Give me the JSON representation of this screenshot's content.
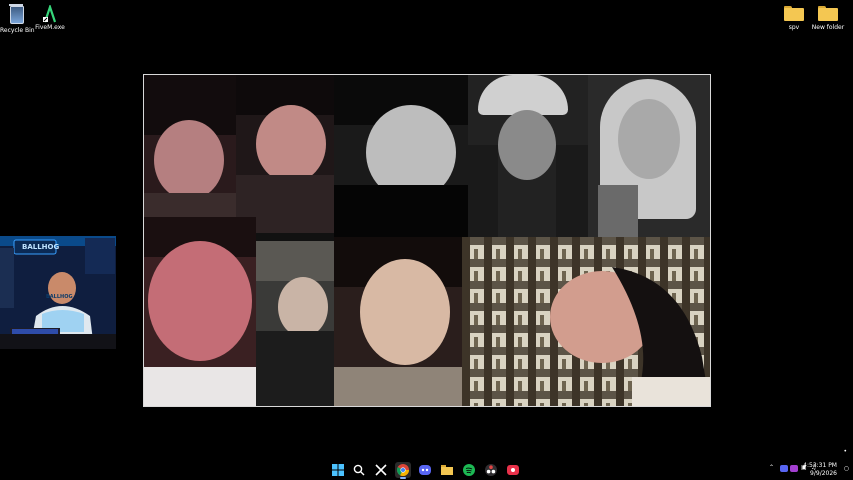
{
  "desktop": {
    "left_icons": [
      {
        "label": "Recycle Bin",
        "icon": "recycle-bin-icon"
      },
      {
        "label": "FiveM.exe",
        "icon": "fivem-icon"
      }
    ],
    "right_icons": [
      {
        "label": "spv",
        "icon": "folder-icon"
      },
      {
        "label": "New folder",
        "icon": "folder-icon"
      }
    ]
  },
  "stream_overlay": {
    "sign_text": "BALLHOG",
    "shirt_text": "BALLHOG"
  },
  "taskbar": {
    "icons": [
      "windows-start-icon",
      "search-icon",
      "capcut-icon",
      "chrome-icon",
      "discord-icon",
      "file-explorer-icon",
      "spotify-icon",
      "obs-icon",
      "app-icon"
    ],
    "tray": {
      "time": "4:53:31 PM",
      "date": "9/9/2026"
    }
  }
}
